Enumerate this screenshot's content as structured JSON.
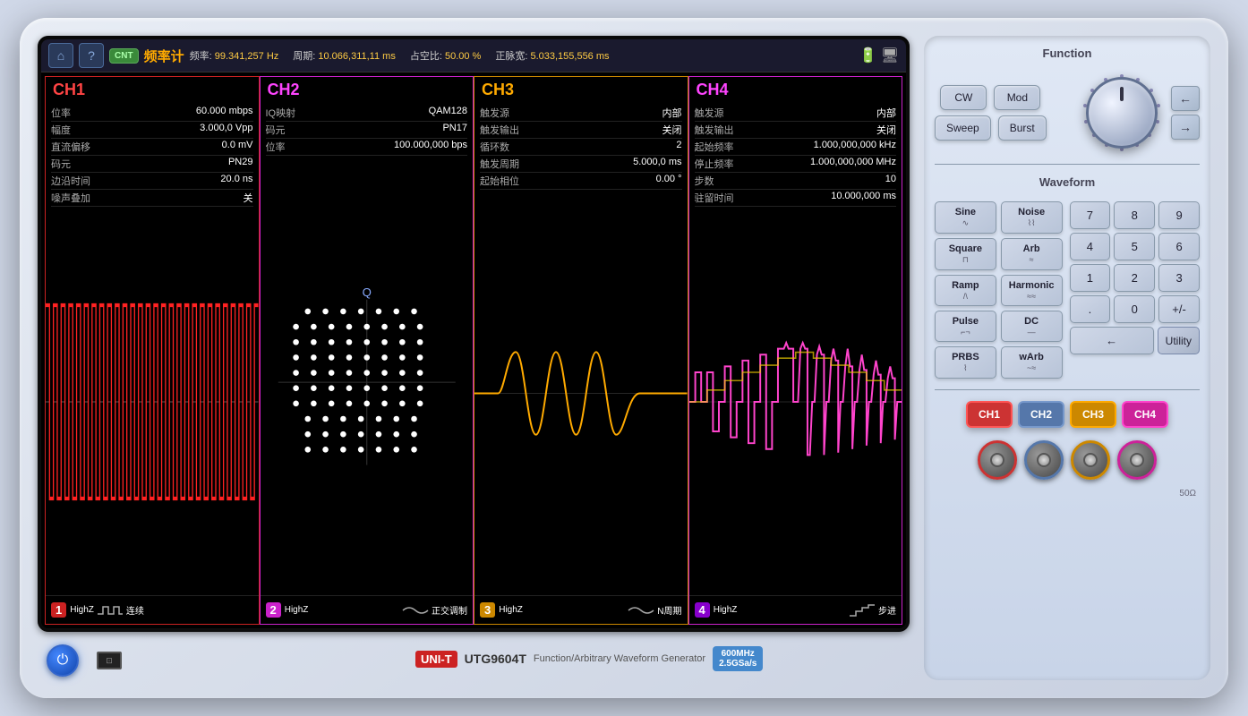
{
  "instrument": {
    "brand": "UNI-T",
    "model": "UTG9604T",
    "description": "Function/Arbitrary Waveform Generator",
    "specs": "600MHz\n2.5GSa/s"
  },
  "screen": {
    "top_bar": {
      "cnt_label": "CNT",
      "title": "频率计",
      "freq_label": "频率:",
      "freq_value": "99.341,257 Hz",
      "period_label": "周期:",
      "period_value": "10.066,311,11 ms",
      "duty_label": "占空比:",
      "duty_value": "50.00 %",
      "pos_width_label": "正脉宽:",
      "pos_width_value": "5.033,155,556 ms"
    },
    "ch1": {
      "name": "CH1",
      "params": [
        {
          "label": "位率",
          "value": "60.000 mbps"
        },
        {
          "label": "幅度",
          "value": "3.000,0 Vpp"
        },
        {
          "label": "直流偏移",
          "value": "0.0 mV"
        },
        {
          "label": "码元",
          "value": "PN29"
        },
        {
          "label": "边沿时间",
          "value": "20.0 ns"
        },
        {
          "label": "噪声叠加",
          "value": "关"
        }
      ],
      "footer": {
        "num": "1",
        "impedance": "HighZ",
        "mode": "连续"
      }
    },
    "ch2": {
      "name": "CH2",
      "params": [
        {
          "label": "IQ映射",
          "value": "QAM128"
        },
        {
          "label": "码元",
          "value": "PN17"
        },
        {
          "label": "位率",
          "value": "100.000,000 bps"
        }
      ],
      "footer": {
        "num": "2",
        "impedance": "HighZ",
        "mode": "正交调制"
      }
    },
    "ch3": {
      "name": "CH3",
      "params": [
        {
          "label": "触发源",
          "value": "内部"
        },
        {
          "label": "触发输出",
          "value": "关闭"
        },
        {
          "label": "循环数",
          "value": "2"
        },
        {
          "label": "触发周期",
          "value": "5.000,0 ms"
        },
        {
          "label": "起始相位",
          "value": "0.00 °"
        }
      ],
      "footer": {
        "num": "3",
        "impedance": "HighZ",
        "mode": "N周期"
      }
    },
    "ch4": {
      "name": "CH4",
      "params": [
        {
          "label": "触发源",
          "value": "内部"
        },
        {
          "label": "触发输出",
          "value": "关闭"
        },
        {
          "label": "起始频率",
          "value": "1.000,000,000 kHz"
        },
        {
          "label": "停止频率",
          "value": "1.000,000,000 MHz"
        },
        {
          "label": "步数",
          "value": "10"
        },
        {
          "label": "驻留时间",
          "value": "10.000,000 ms"
        }
      ],
      "footer": {
        "num": "4",
        "impedance": "HighZ",
        "mode": "步进"
      }
    }
  },
  "right_panel": {
    "function_title": "Function",
    "waveform_title": "Waveform",
    "function_btns": {
      "cw": "CW",
      "mod": "Mod",
      "sweep": "Sweep",
      "burst": "Burst"
    },
    "waveform_btns": [
      {
        "label": "Sine",
        "icon": "∿"
      },
      {
        "label": "Noise",
        "icon": "⌇"
      },
      {
        "label": "Square",
        "icon": "⊓"
      },
      {
        "label": "Arb",
        "icon": "∿"
      },
      {
        "label": "Ramp",
        "icon": "/\\"
      },
      {
        "label": "Harmonic",
        "icon": "≈"
      },
      {
        "label": "Pulse",
        "icon": "⌐¬"
      },
      {
        "label": "DC",
        "icon": "—"
      },
      {
        "label": "PRBS",
        "icon": "⌇"
      },
      {
        "label": "wArb",
        "icon": "≈"
      }
    ],
    "numpad": [
      "7",
      "8",
      "9",
      "4",
      "5",
      "6",
      "1",
      "2",
      "3",
      ".",
      "0",
      "+/-"
    ],
    "utility_btn": "Utility",
    "channel_btns": [
      "CH1",
      "CH2",
      "CH3",
      "CH4"
    ],
    "ohm_label": "50Ω"
  }
}
